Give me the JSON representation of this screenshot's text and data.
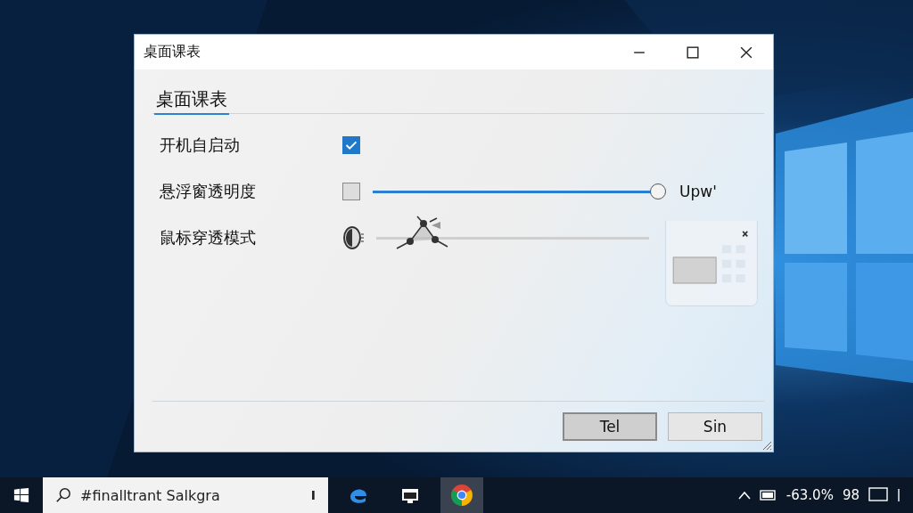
{
  "window": {
    "title": "桌面课表"
  },
  "header": "桌面课表",
  "settings": [
    {
      "kind": "checkbox",
      "label": "开机自启动",
      "checked": true
    },
    {
      "kind": "slider",
      "label": "悬浮窗透明度",
      "checked": false,
      "level": 1,
      "reading": "Upw'"
    },
    {
      "kind": "icon-slider",
      "label": "鼠标穿透模式"
    }
  ],
  "buttons": [
    {
      "label": "Tel",
      "default": true
    },
    {
      "label": "Sin",
      "default": false
    }
  ],
  "taskbar": {
    "search": {
      "value": "#finalltrant Salkgra",
      "key": "I"
    },
    "tray_reading": "-63.0%",
    "tray_number": "98"
  }
}
